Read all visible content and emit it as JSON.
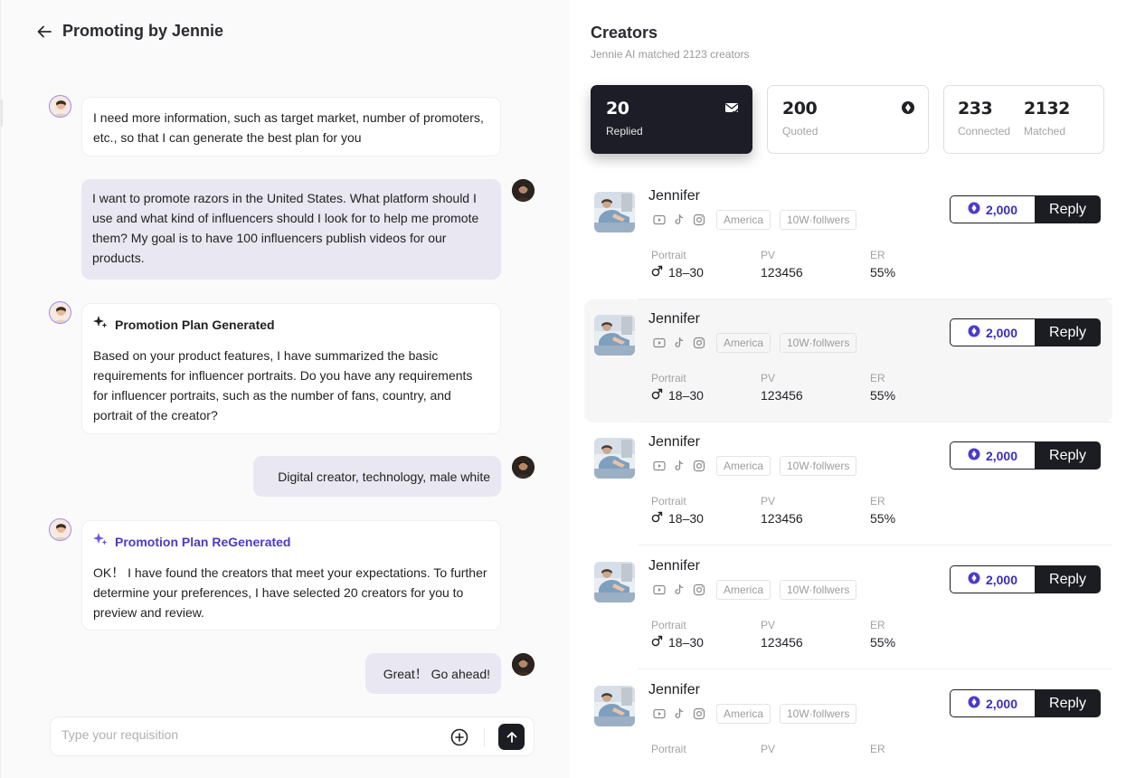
{
  "header": {
    "title": "Promoting by Jennie"
  },
  "chat": {
    "m1": "I need more information, such as target market, number of promoters, etc., so that I can generate the best plan for you",
    "m2": "I want to promote razors in the United States. What platform should I use and what kind of influencers should I look for to help me promote them? My goal is to have 100 influencers publish videos for our products.",
    "m3_title": "Promotion Plan Generated",
    "m3": "Based on your product features, I have summarized the basic requirements for influencer portraits. Do you have any requirements for influencer portraits, such as the number of fans, country, and portrait of the creator?",
    "m4": "Digital creator, technology, male white",
    "m5_title": "Promotion Plan ReGenerated",
    "m5": "OK！ I have found the creators that meet your expectations. To further determine your preferences, I have selected 20 creators for you to preview and review.",
    "m6": "Great！ Go ahead!"
  },
  "composer": {
    "placeholder": "Type your requisition"
  },
  "creators_panel": {
    "title": "Creators",
    "subtitle": "Jennie AI matched 2123 creators",
    "stats": {
      "replied": {
        "value": "20",
        "label": "Replied"
      },
      "quoted": {
        "value": "200",
        "label": "Quoted"
      },
      "connected": {
        "value": "233",
        "label": "Connected"
      },
      "matched": {
        "value": "2132",
        "label": "Matched"
      }
    },
    "labels": {
      "portrait": "Portrait",
      "pv": "PV",
      "er": "ER",
      "reply": "Reply"
    },
    "items": [
      {
        "name": "Jennifer",
        "region": "America",
        "followers": "10W·follwers",
        "age": "18–30",
        "pv": "123456",
        "er": "55%",
        "price": "2,000"
      },
      {
        "name": "Jennifer",
        "region": "America",
        "followers": "10W·follwers",
        "age": "18–30",
        "pv": "123456",
        "er": "55%",
        "price": "2,000"
      },
      {
        "name": "Jennifer",
        "region": "America",
        "followers": "10W·follwers",
        "age": "18–30",
        "pv": "123456",
        "er": "55%",
        "price": "2,000"
      },
      {
        "name": "Jennifer",
        "region": "America",
        "followers": "10W·follwers",
        "age": "18–30",
        "pv": "123456",
        "er": "55%",
        "price": "2,000"
      },
      {
        "name": "Jennifer",
        "region": "America",
        "followers": "10W·follwers",
        "age": "",
        "pv": "",
        "er": "",
        "price": "2,000"
      }
    ]
  },
  "colors": {
    "accent": "#3a2ec2",
    "dark": "#1c1d22",
    "user_bubble": "#e8e7f2"
  }
}
